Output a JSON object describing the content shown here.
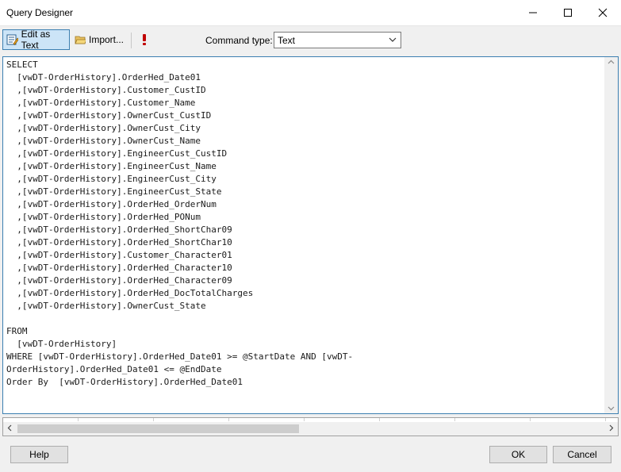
{
  "window": {
    "title": "Query Designer"
  },
  "toolbar": {
    "edit_as_text_label": "Edit as Text",
    "import_label": "Import...",
    "command_type_label": "Command type:",
    "command_type_value": "Text"
  },
  "editor": {
    "query_text": "SELECT\n  [vwDT-OrderHistory].OrderHed_Date01\n  ,[vwDT-OrderHistory].Customer_CustID\n  ,[vwDT-OrderHistory].Customer_Name\n  ,[vwDT-OrderHistory].OwnerCust_CustID\n  ,[vwDT-OrderHistory].OwnerCust_City\n  ,[vwDT-OrderHistory].OwnerCust_Name\n  ,[vwDT-OrderHistory].EngineerCust_CustID\n  ,[vwDT-OrderHistory].EngineerCust_Name\n  ,[vwDT-OrderHistory].EngineerCust_City\n  ,[vwDT-OrderHistory].EngineerCust_State\n  ,[vwDT-OrderHistory].OrderHed_OrderNum\n  ,[vwDT-OrderHistory].OrderHed_PONum\n  ,[vwDT-OrderHistory].OrderHed_ShortChar09\n  ,[vwDT-OrderHistory].OrderHed_ShortChar10\n  ,[vwDT-OrderHistory].Customer_Character01\n  ,[vwDT-OrderHistory].OrderHed_Character10\n  ,[vwDT-OrderHistory].OrderHed_Character09\n  ,[vwDT-OrderHistory].OrderHed_DocTotalCharges\n  ,[vwDT-OrderHistory].OwnerCust_State\n\nFROM\n  [vwDT-OrderHistory]\nWHERE [vwDT-OrderHistory].OrderHed_Date01 >= @StartDate AND [vwDT-\nOrderHistory].OrderHed_Date01 <= @EndDate\nOrder By  [vwDT-OrderHistory].OrderHed_Date01"
  },
  "footer": {
    "help_label": "Help",
    "ok_label": "OK",
    "cancel_label": "Cancel"
  },
  "icons": {
    "edit_as_text": "edit-text-icon",
    "import": "folder-open-icon",
    "run": "exclamation-icon",
    "dropdown": "chevron-down-icon"
  },
  "colors": {
    "accent": "#3c7fb1",
    "active_button_bg": "#cce4f7",
    "run_icon": "#c00000"
  }
}
